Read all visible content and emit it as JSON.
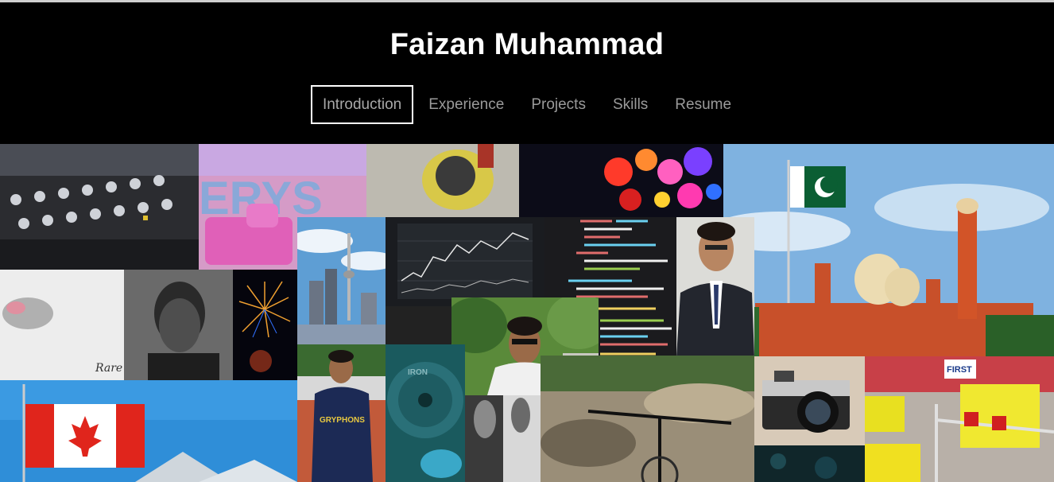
{
  "site": {
    "title": "Faizan Muhammad"
  },
  "nav": {
    "items": [
      {
        "label": "Introduction",
        "active": true
      },
      {
        "label": "Experience",
        "active": false
      },
      {
        "label": "Projects",
        "active": false
      },
      {
        "label": "Skills",
        "active": false
      },
      {
        "label": "Resume",
        "active": false
      }
    ]
  },
  "collage": {
    "album_text": "ERYS",
    "album_script": "Rare",
    "jersey_text": "GRYPHONS",
    "banner_text": "FIRST",
    "plate_text": "IRON"
  },
  "colors": {
    "header_bg": "#000000",
    "title": "#ffffff",
    "nav_text": "#9a9a9a",
    "active_border": "#ffffff"
  }
}
